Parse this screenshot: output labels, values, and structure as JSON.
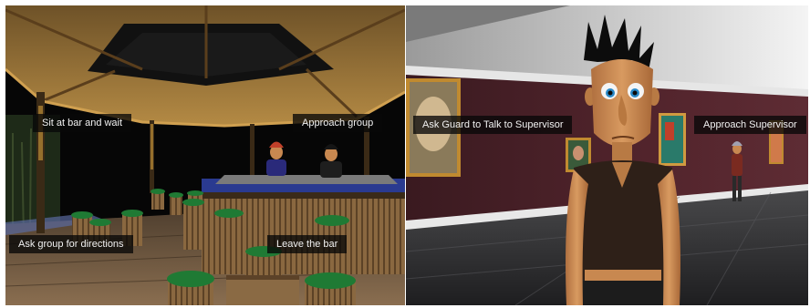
{
  "bar_scene": {
    "choices": {
      "sit": "Sit at bar and wait",
      "approach_group": "Approach group",
      "ask_directions": "Ask group for directions",
      "leave": "Leave the bar"
    }
  },
  "gallery_scene": {
    "choices": {
      "ask_guard": "Ask Guard to Talk to Supervisor",
      "approach_supervisor": "Approach Supervisor"
    }
  },
  "colors": {
    "wall": "#4a1f26",
    "floor": "#2b2b2d",
    "thatch": "#a0783a",
    "stool_seat": "#1f7a34",
    "skin": "#c88850",
    "hair": "#101010"
  }
}
